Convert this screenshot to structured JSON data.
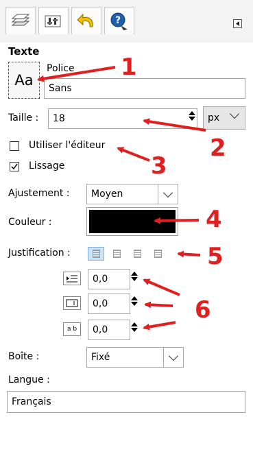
{
  "panel": {
    "section_title": "Texte",
    "font_label": "Police",
    "font_preview": "Aa",
    "font_value": "Sans",
    "size_label": "Taille :",
    "size_value": "18",
    "unit_value": "px",
    "use_editor_label": "Utiliser l'éditeur",
    "antialias_label": "Lissage",
    "hinting_label": "Ajustement :",
    "hinting_value": "Moyen",
    "color_label": "Couleur :",
    "color_value": "#000000",
    "justify_label": "Justification :",
    "indent_value": "0,0",
    "line_spacing_value": "0,0",
    "letter_spacing_value": "0,0",
    "letter_spacing_icon_text": "a b",
    "box_label": "Boîte :",
    "box_value": "Fixé",
    "language_label": "Langue :",
    "language_value": "Français"
  },
  "annotations": [
    "1",
    "2",
    "3",
    "4",
    "5",
    "6"
  ],
  "colors": {
    "annotation": "#e02020",
    "accent_selected": "#cce4f7"
  }
}
